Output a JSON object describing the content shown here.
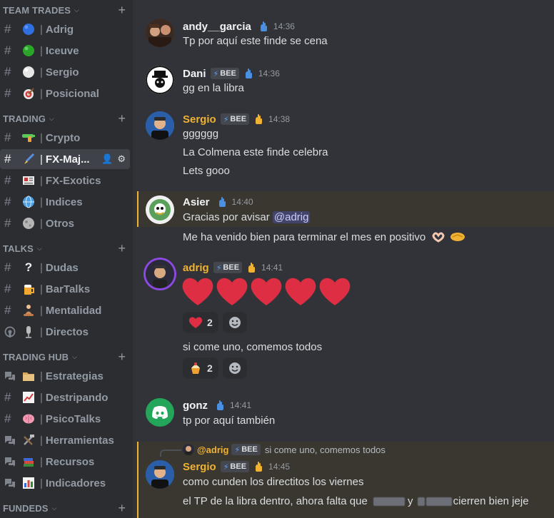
{
  "sidebar": {
    "categories": [
      {
        "name": "TEAM TRADES"
      },
      {
        "name": "TRADING"
      },
      {
        "name": "TALKS"
      },
      {
        "name": "TRADING HUB"
      },
      {
        "name": "FUNDEDS"
      }
    ],
    "channels": [
      {
        "emoji": "blue-circle",
        "name": "Adrig"
      },
      {
        "emoji": "green-circle",
        "name": "Iceuve"
      },
      {
        "emoji": "white-circle",
        "name": "Sergio"
      },
      {
        "emoji": "target",
        "name": "Posicional"
      },
      {
        "emoji": "water-gun",
        "name": "Crypto"
      },
      {
        "emoji": "paintbrush",
        "name": "FX-Maj..."
      },
      {
        "emoji": "newspaper",
        "name": "FX-Exotics"
      },
      {
        "emoji": "globe",
        "name": "Indices"
      },
      {
        "emoji": "moon",
        "name": "Otros"
      },
      {
        "emoji": "question",
        "name": "Dudas"
      },
      {
        "emoji": "beer",
        "name": "BarTalks"
      },
      {
        "emoji": "meditation",
        "name": "Mentalidad"
      },
      {
        "emoji": "microphone",
        "name": "Directos"
      },
      {
        "emoji": "folder",
        "name": "Estrategias"
      },
      {
        "emoji": "chart",
        "name": "Destripando"
      },
      {
        "emoji": "brain",
        "name": "PsicoTalks"
      },
      {
        "emoji": "tools",
        "name": "Herramientas"
      },
      {
        "emoji": "books",
        "name": "Recursos"
      },
      {
        "emoji": "bar-chart",
        "name": "Indicadores"
      }
    ],
    "separator": "|"
  },
  "messages": [
    {
      "user": "andy__garcia",
      "time": "14:36",
      "lines": [
        "Tp por aquí este finde se cena"
      ]
    },
    {
      "user": "Dani",
      "tag": "BEE",
      "time": "14:36",
      "lines": [
        "gg en la libra"
      ]
    },
    {
      "user": "Sergio",
      "tag": "BEE",
      "time": "14:38",
      "lines": [
        "gggggg",
        "La Colmena este finde celebra",
        "Lets gooo"
      ]
    },
    {
      "user": "Asier",
      "time": "14:40",
      "line1_prefix": "Gracias por avisar ",
      "mention": "@adrig",
      "line2": "Me ha venido bien para terminar el mes en positivo"
    },
    {
      "user": "adrig",
      "tag": "BEE",
      "time": "14:41",
      "reaction1_count": "2",
      "line2": "si come uno, comemos todos",
      "reaction2_count": "2"
    },
    {
      "user": "gonz",
      "time": "14:41",
      "lines": [
        "tp por aquí también"
      ]
    },
    {
      "user": "Sergio",
      "tag": "BEE",
      "time": "14:45",
      "reply_user": "@adrig",
      "reply_tag": "BEE",
      "reply_text": "si come uno, comemos todos",
      "lines": [
        "como cunden los directitos los viernes"
      ],
      "line2_a": "el TP de la libra dentro, ahora falta que",
      "line2_b": "y",
      "line2_c": "cierren bien jeje"
    }
  ],
  "colors": {
    "sergio": "#f0b232",
    "adrig": "#f0b232",
    "default_user": "#f2f3f5",
    "highlight": "#f0b232"
  }
}
